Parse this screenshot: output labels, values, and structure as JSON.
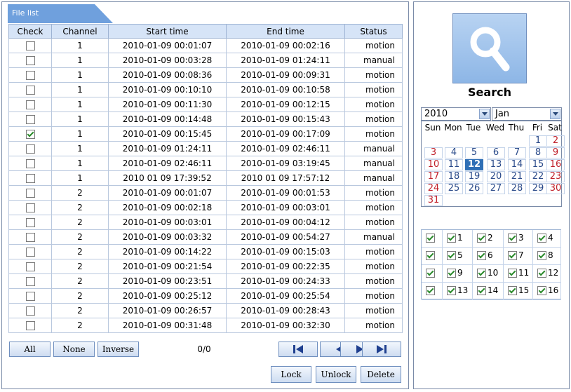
{
  "tab_title": "File list",
  "columns": [
    "Check",
    "Channel",
    "Start time",
    "End time",
    "Status"
  ],
  "rows": [
    {
      "checked": false,
      "channel": "1",
      "start": "2010-01-09 00:01:07",
      "end": "2010-01-09 00:02:16",
      "status": "motion"
    },
    {
      "checked": false,
      "channel": "1",
      "start": "2010-01-09 00:03:28",
      "end": "2010-01-09 01:24:11",
      "status": "manual"
    },
    {
      "checked": false,
      "channel": "1",
      "start": "2010-01-09 00:08:36",
      "end": "2010-01-09 00:09:31",
      "status": "motion"
    },
    {
      "checked": false,
      "channel": "1",
      "start": "2010-01-09 00:10:10",
      "end": "2010-01-09 00:10:58",
      "status": "motion"
    },
    {
      "checked": false,
      "channel": "1",
      "start": "2010-01-09 00:11:30",
      "end": "2010-01-09 00:12:15",
      "status": "motion"
    },
    {
      "checked": false,
      "channel": "1",
      "start": "2010-01-09 00:14:48",
      "end": "2010-01-09 00:15:43",
      "status": "motion"
    },
    {
      "checked": true,
      "channel": "1",
      "start": "2010-01-09 00:15:45",
      "end": "2010-01-09 00:17:09",
      "status": "motion"
    },
    {
      "checked": false,
      "channel": "1",
      "start": "2010-01-09 01:24:11",
      "end": "2010-01-09 02:46:11",
      "status": "manual"
    },
    {
      "checked": false,
      "channel": "1",
      "start": "2010-01-09 02:46:11",
      "end": "2010-01-09 03:19:45",
      "status": "manual"
    },
    {
      "checked": false,
      "channel": "1",
      "start": "2010 01 09 17:39:52",
      "end": "2010 01 09 17:57:12",
      "status": "manual"
    },
    {
      "checked": false,
      "channel": "2",
      "start": "2010-01-09 00:01:07",
      "end": "2010-01-09 00:01:53",
      "status": "motion"
    },
    {
      "checked": false,
      "channel": "2",
      "start": "2010-01-09 00:02:18",
      "end": "2010-01-09 00:03:01",
      "status": "motion"
    },
    {
      "checked": false,
      "channel": "2",
      "start": "2010-01-09 00:03:01",
      "end": "2010-01-09 00:04:12",
      "status": "motion"
    },
    {
      "checked": false,
      "channel": "2",
      "start": "2010-01-09 00:03:32",
      "end": "2010-01-09 00:54:27",
      "status": "manual"
    },
    {
      "checked": false,
      "channel": "2",
      "start": "2010-01-09 00:14:22",
      "end": "2010-01-09 00:15:03",
      "status": "motion"
    },
    {
      "checked": false,
      "channel": "2",
      "start": "2010-01-09 00:21:54",
      "end": "2010-01-09 00:22:35",
      "status": "motion"
    },
    {
      "checked": false,
      "channel": "2",
      "start": "2010-01-09 00:23:51",
      "end": "2010-01-09 00:24:33",
      "status": "motion"
    },
    {
      "checked": false,
      "channel": "2",
      "start": "2010-01-09 00:25:12",
      "end": "2010-01-09 00:25:54",
      "status": "motion"
    },
    {
      "checked": false,
      "channel": "2",
      "start": "2010-01-09 00:26:57",
      "end": "2010-01-09 00:28:43",
      "status": "motion"
    },
    {
      "checked": false,
      "channel": "2",
      "start": "2010-01-09 00:31:48",
      "end": "2010-01-09 00:32:30",
      "status": "motion"
    }
  ],
  "buttons": {
    "all": "All",
    "none": "None",
    "inverse": "Inverse",
    "lock": "Lock",
    "unlock": "Unlock",
    "delete": "Delete"
  },
  "page_info": "0/0",
  "nav": [
    "first-page-icon",
    "prev-page-icon",
    "next-page-icon",
    "last-page-icon"
  ],
  "search": {
    "label": "Search",
    "icon": "search-icon"
  },
  "calendar": {
    "year": "2010",
    "month": "Jan",
    "weekdays": [
      "Sun",
      "Mon",
      "Tue",
      "Wed",
      "Thu",
      "Fri",
      "Sat"
    ],
    "selected_day": "12",
    "days": [
      "1",
      "2",
      "3",
      "4",
      "5",
      "6",
      "7",
      "8",
      "9",
      "10",
      "11",
      "12",
      "13",
      "14",
      "15",
      "16",
      "17",
      "18",
      "19",
      "20",
      "21",
      "22",
      "23",
      "24",
      "25",
      "26",
      "27",
      "28",
      "29",
      "30",
      "31"
    ]
  },
  "channels": {
    "rows": [
      {
        "all": true,
        "items": [
          {
            "label": "1",
            "checked": true
          },
          {
            "label": "2",
            "checked": true
          },
          {
            "label": "3",
            "checked": true
          },
          {
            "label": "4",
            "checked": true
          }
        ]
      },
      {
        "all": true,
        "items": [
          {
            "label": "5",
            "checked": true
          },
          {
            "label": "6",
            "checked": true
          },
          {
            "label": "7",
            "checked": true
          },
          {
            "label": "8",
            "checked": true
          }
        ]
      },
      {
        "all": true,
        "items": [
          {
            "label": "9",
            "checked": true
          },
          {
            "label": "10",
            "checked": true
          },
          {
            "label": "11",
            "checked": true
          },
          {
            "label": "12",
            "checked": true
          }
        ]
      },
      {
        "all": true,
        "items": [
          {
            "label": "13",
            "checked": true
          },
          {
            "label": "14",
            "checked": true
          },
          {
            "label": "15",
            "checked": true
          },
          {
            "label": "16",
            "checked": true
          }
        ]
      }
    ]
  },
  "colors": {
    "accent": "#6fa0dd",
    "header_bg": "#d6e4f7",
    "weekend": "#c0202a",
    "selected_day": "#2f6fb6"
  }
}
